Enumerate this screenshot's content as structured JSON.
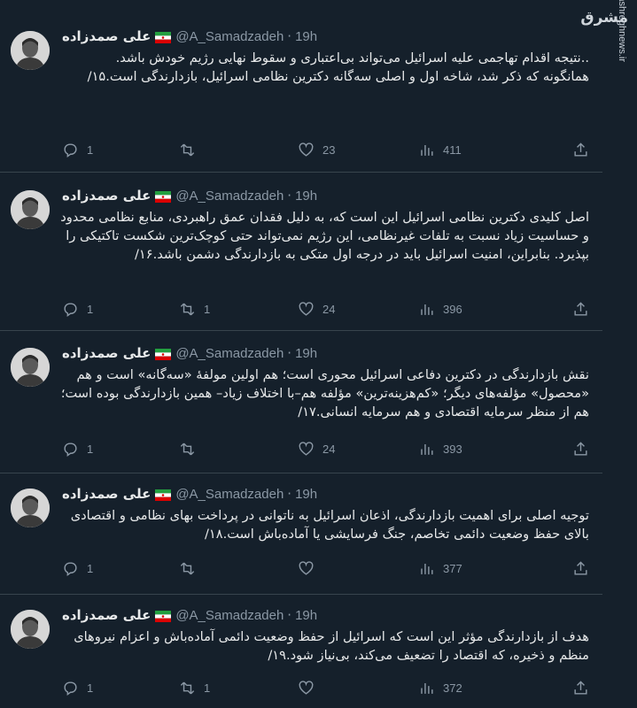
{
  "watermark": {
    "logo": "مشرق",
    "site": "mashreghnews.ir"
  },
  "author": {
    "name": "علی صمدزاده",
    "handle": "@A_Samadzadeh",
    "time": "19h"
  },
  "tweets": [
    {
      "text": "..نتیجه اقدام تهاجمی علیه اسرائیل می‌تواند بی‌اعتباری و سقوط نهایی رژیم خودش باشد.\nهمانگونه که ذکر شد، شاخه اول و اصلی سه‌گانه دکترین نظامی اسرائیل، بازدارندگی است.۱۵/",
      "replies": "1",
      "retweets": "",
      "likes": "23",
      "views": "411"
    },
    {
      "text": "اصل کلیدی دکترین نظامی اسرائیل این است که، به دلیل فقدان عمق راهبردی، منابع نظامی محدود و حساسیت زیاد نسبت به تلفات غیرنظامی، این رژیم نمی‌تواند حتی کوچک‌ترین شکست تاکتیکی را بپذیرد. بنابراین، امنیت اسرائیل باید در درجه اول متکی به بازدارندگی دشمن باشد.۱۶/",
      "replies": "1",
      "retweets": "1",
      "likes": "24",
      "views": "396"
    },
    {
      "text": "نقش بازدارندگی در دکترین دفاعی اسرائیل محوری است؛ هم اولین مولفهٔ «سه‌گانه» است و هم «محصول» مؤلفه‌های دیگر؛ «کم‌هزینه‌ترین» مؤلفه هم–با اختلاف زیاد– همین بازدارندگی بوده است؛ هم از منظر سرمایه اقتصادی و هم سرمایه انسانی.۱۷/",
      "replies": "1",
      "retweets": "",
      "likes": "24",
      "views": "393"
    },
    {
      "text": "توجیه اصلی برای اهمیت بازدارندگی، اذعان اسرائیل به ناتوانی در پرداخت بهای نظامی و اقتصادی بالای حفظ وضعیت دائمی تخاصم، جنگ فرسایشی یا آماده‌باش است.۱۸/",
      "replies": "1",
      "retweets": "",
      "likes": "",
      "views": "377"
    },
    {
      "text": "هدف از بازدارندگی مؤثر این است که اسرائیل از حفظ وضعیت دائمی آماده‌باش و اعزام نیروهای منظم و ذخیره، که اقتصاد را تضعیف می‌کند، بی‌نیاز شود.۱۹/",
      "replies": "1",
      "retweets": "1",
      "likes": "",
      "views": "372"
    }
  ]
}
